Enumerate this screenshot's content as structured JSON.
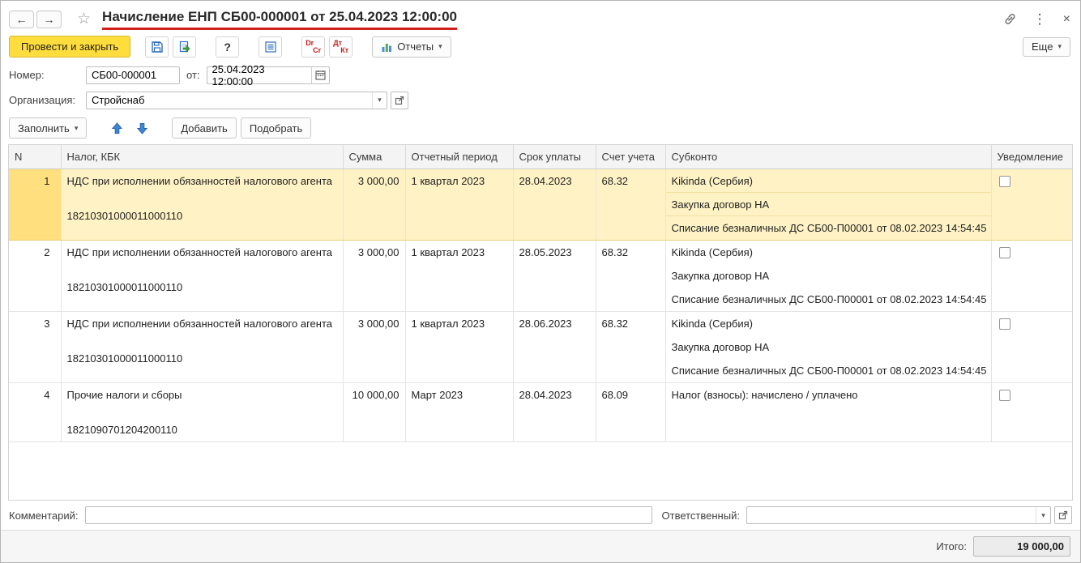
{
  "window": {
    "title": "Начисление ЕНП СБ00-000001 от 25.04.2023 12:00:00",
    "menu_glyph": "⋮",
    "close_glyph": "×"
  },
  "titlebar": {
    "back_glyph": "←",
    "forward_glyph": "→",
    "star_glyph": "☆"
  },
  "ui": {
    "dropdown_glyph": "▾"
  },
  "toolbar": {
    "post_and_close": "Провести и закрыть",
    "help_glyph": "?",
    "drcr_latin_top": "Dr",
    "drcr_latin_bottom": "Cr",
    "drcr_cyr_top": "Дт",
    "drcr_cyr_bottom": "Кт",
    "reports_label": "Отчеты",
    "more_label": "Еще"
  },
  "fields": {
    "number_label": "Номер:",
    "number_value": "СБ00-000001",
    "date_label": "от:",
    "date_value": "25.04.2023 12:00:00",
    "organization_label": "Организация:",
    "organization_value": "Стройснаб"
  },
  "table_toolbar": {
    "fill_label": "Заполнить",
    "add_label": "Добавить",
    "pick_label": "Подобрать"
  },
  "table": {
    "columns": [
      "N",
      "Налог, КБК",
      "Сумма",
      "Отчетный период",
      "Срок уплаты",
      "Счет учета",
      "Субконто",
      "Уведомление"
    ],
    "rows": [
      {
        "n": "1",
        "tax": "НДС при исполнении обязанностей налогового агента",
        "kbk": "18210301000011000110",
        "sum": "3 000,00",
        "period": "1 квартал 2023",
        "due": "28.04.2023",
        "account": "68.32",
        "subconto": [
          "Kikinda (Сербия)",
          "Закупка договор НА",
          "Списание безналичных ДС СБ00-П00001 от 08.02.2023 14:54:45"
        ],
        "selected": true,
        "notification_checked": false
      },
      {
        "n": "2",
        "tax": "НДС при исполнении обязанностей налогового агента",
        "kbk": "18210301000011000110",
        "sum": "3 000,00",
        "period": "1 квартал 2023",
        "due": "28.05.2023",
        "account": "68.32",
        "subconto": [
          "Kikinda (Сербия)",
          "Закупка договор НА",
          "Списание безналичных ДС СБ00-П00001 от 08.02.2023 14:54:45"
        ],
        "selected": false,
        "notification_checked": false
      },
      {
        "n": "3",
        "tax": "НДС при исполнении обязанностей налогового агента",
        "kbk": "18210301000011000110",
        "sum": "3 000,00",
        "period": "1 квартал 2023",
        "due": "28.06.2023",
        "account": "68.32",
        "subconto": [
          "Kikinda (Сербия)",
          "Закупка договор НА",
          "Списание безналичных ДС СБ00-П00001 от 08.02.2023 14:54:45"
        ],
        "selected": false,
        "notification_checked": false
      },
      {
        "n": "4",
        "tax": "Прочие налоги и сборы",
        "kbk": "1821090701204200110",
        "sum": "10 000,00",
        "period": "Март 2023",
        "due": "28.04.2023",
        "account": "68.09",
        "subconto": [
          "Налог (взносы): начислено / уплачено"
        ],
        "selected": false,
        "notification_checked": false
      }
    ]
  },
  "footer": {
    "comment_label": "Комментарий:",
    "responsible_label": "Ответственный:",
    "responsible_value": "",
    "comment_value": "",
    "total_label": "Итого:",
    "total_value": "19 000,00"
  },
  "colors": {
    "accent_underline": "#d4201a",
    "primary_button_bg": "#ffdd3c",
    "selected_row_bg": "#fff3c5",
    "selected_row_num_bg": "#ffdf7e"
  }
}
